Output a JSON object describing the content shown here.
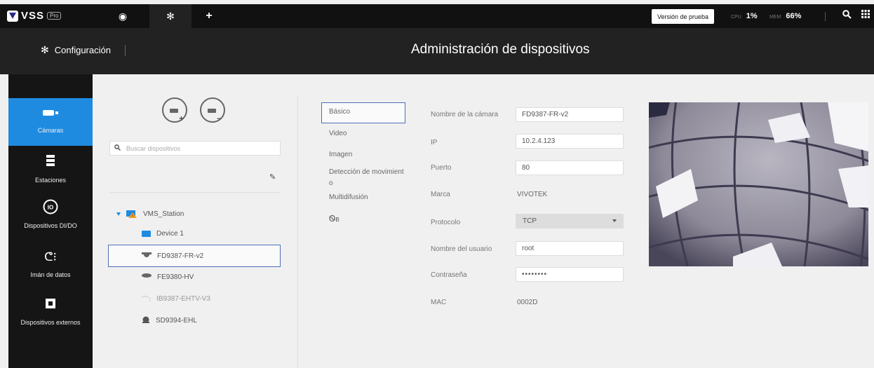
{
  "topbar": {
    "logo_text": "VSS",
    "logo_badge": "Pro",
    "tabs": [
      {
        "icon": "eye-icon",
        "glyph": "◉"
      },
      {
        "icon": "gear-icon",
        "glyph": "✻"
      },
      {
        "icon": "plus-icon",
        "glyph": "+"
      }
    ],
    "trial_button": "Versión de prueba",
    "cpu_label": "CPU",
    "cpu_value": "1%",
    "mem_label": "MEM",
    "mem_value": "66%"
  },
  "header": {
    "section": "Configuración",
    "title": "Administración de dispositivos"
  },
  "leftnav": {
    "items": [
      {
        "label": "Cámaras",
        "icon": "camera-icon",
        "active": true
      },
      {
        "label": "Estaciones",
        "icon": "server-icon"
      },
      {
        "label": "Dispositivos DI/DO",
        "icon": "io-icon"
      },
      {
        "label": "Imán de datos",
        "icon": "data-magnet-icon"
      },
      {
        "label": "Dispositivos externos",
        "icon": "external-device-icon"
      }
    ]
  },
  "devices": {
    "search_placeholder": "Buscar dispositivos",
    "tree": [
      {
        "label": "VMS_Station",
        "icon": "station-icon"
      },
      {
        "label": "Device 1",
        "icon": "folder-icon"
      },
      {
        "label": "FD9387-FR-v2",
        "icon": "dome-camera-icon",
        "selected": true
      },
      {
        "label": "FE9380-HV",
        "icon": "fisheye-camera-icon"
      },
      {
        "label": "IB9387-EHTV-V3",
        "icon": "bullet-camera-icon"
      },
      {
        "label": "SD9394-EHL",
        "icon": "ptz-camera-icon"
      }
    ]
  },
  "settings_tabs": {
    "basic": "Básico",
    "video": "Video",
    "image": "Imagen",
    "motion_line1": "Detección de movimient",
    "motion_line2": "o",
    "multicast": "Multidifusión",
    "extra_icon": "Ꮻ",
    "extra_suffix": "B"
  },
  "form": {
    "camera_name_label": "Nombre de la cámara",
    "camera_name": "FD9387-FR-v2",
    "ip_label": "IP",
    "ip": "10.2.4.123",
    "port_label": "Puerto",
    "port": "80",
    "brand_label": "Marca",
    "brand": "VIVOTEK",
    "protocol_label": "Protocolo",
    "protocol": "TCP",
    "username_label": "Nombre del usuario",
    "username": "root",
    "password_label": "Contraseña",
    "password": "••••••••",
    "mac_label": "MAC",
    "mac": "0002D"
  },
  "colors": {
    "accent": "#1f8be0",
    "selection_border": "#4e6fb8"
  }
}
